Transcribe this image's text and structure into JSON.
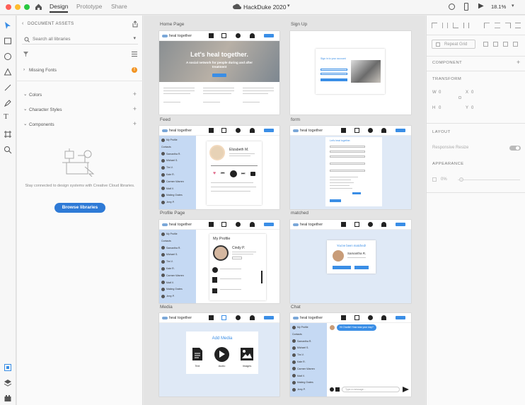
{
  "window": {
    "title": "HackDuke 2020",
    "zoom": "18.1%",
    "tabs": [
      "Design",
      "Prototype",
      "Share"
    ]
  },
  "assets": {
    "header": "DOCUMENT ASSETS",
    "search_placeholder": "Search all libraries",
    "missing_fonts": "Missing Fonts",
    "sections": [
      "Colors",
      "Character Styles",
      "Components"
    ],
    "info": "Stay connected to design systems with Creative Cloud libraries.",
    "browse": "Browse libraries"
  },
  "artboards": {
    "home": {
      "label": "Home Page",
      "hero_title": "Let's heal together.",
      "hero_sub": "A social network for people during and after treatment",
      "brand": "heal together"
    },
    "signup": {
      "label": "Sign Up",
      "title": "Sign in to your account"
    },
    "feed": {
      "label": "Feed",
      "name": "Elizabeth M."
    },
    "form": {
      "label": "form",
      "title": "Let's heal together."
    },
    "profile": {
      "label": "Profile Page",
      "title": "My Profile",
      "name": "Cindy P."
    },
    "matched": {
      "label": "matched",
      "title": "You've been matched!",
      "name": "Samantha R."
    },
    "media": {
      "label": "Media",
      "title": "Add Media",
      "opts": [
        "Text",
        "Audio",
        "Images"
      ]
    },
    "chat": {
      "label": "Chat",
      "msg": "Hi Charlie! How was your day?",
      "placeholder": "Type a message..."
    }
  },
  "sidebar_contacts": [
    "My Profile",
    "Contacts",
    "Samantha R.",
    "Michael S.",
    "Tim V.",
    "Kate R.",
    "Carmen Warren",
    "Matt V.",
    "Making Grates",
    "Jerry P."
  ],
  "props": {
    "repeat_grid": "Repeat Grid",
    "component": "COMPONENT",
    "transform": "TRANSFORM",
    "w": "W",
    "h": "H",
    "x": "X",
    "y": "Y",
    "zero": "0",
    "layout": "LAYOUT",
    "responsive": "Responsive Resize",
    "appearance": "APPEARANCE",
    "opacity": "0%"
  }
}
